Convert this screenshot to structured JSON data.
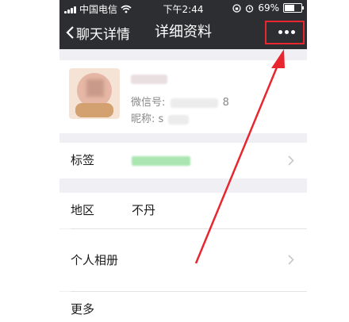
{
  "status_bar": {
    "carrier": "中国电信",
    "time": "下午2:44",
    "battery": "69%",
    "battery_level": 0.69,
    "icons": [
      "signal-icon",
      "wifi-icon",
      "rotation-lock-icon",
      "alarm-icon",
      "battery-icon"
    ]
  },
  "nav": {
    "back_label": "聊天详情",
    "title": "详细资料",
    "more_icon": "more-dots-icon"
  },
  "profile": {
    "wechat_id_label": "微信号:",
    "wechat_id_suffix": "8",
    "nickname_label": "昵称:",
    "nickname_partial": "s"
  },
  "rows": {
    "tags": {
      "label": "标签"
    },
    "region": {
      "label": "地区",
      "value": "不丹"
    },
    "album": {
      "label": "个人相册"
    },
    "more": {
      "label": "更多"
    }
  },
  "colors": {
    "nav_background": "#2d2e32",
    "page_background": "#efeff4",
    "annotation_red": "#e8262f"
  }
}
